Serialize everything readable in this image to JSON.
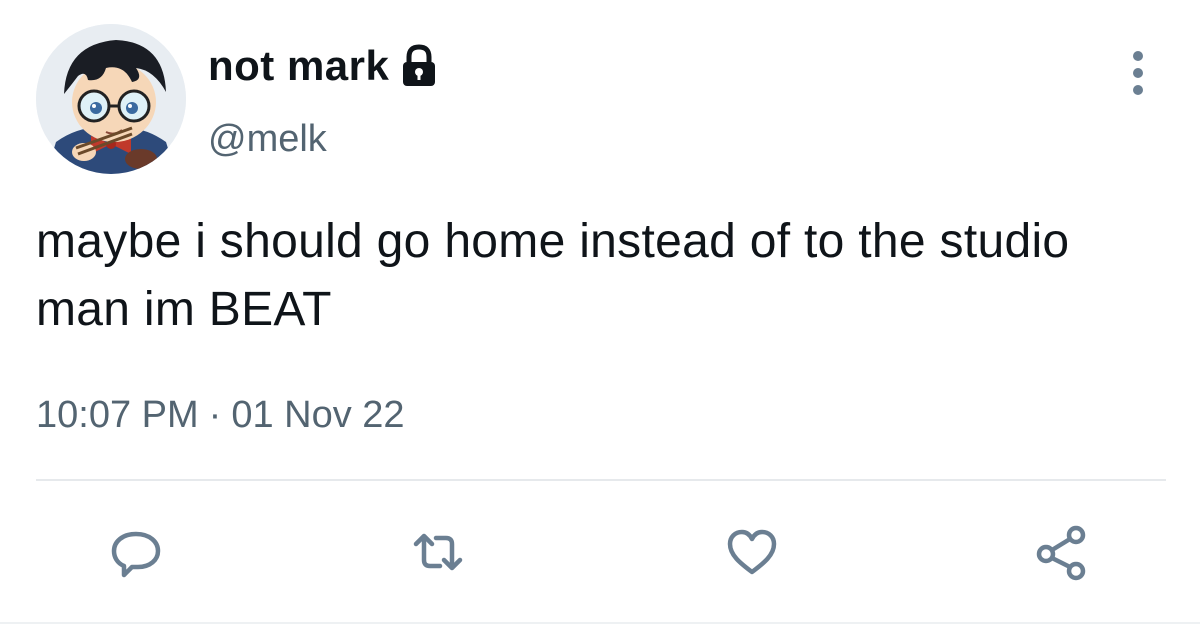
{
  "user": {
    "display_name": "not mark",
    "handle": "@melk",
    "avatar_icon": "avatar-anime-boy-glasses",
    "protected_icon": "lock-icon"
  },
  "tweet": {
    "text": "maybe i should go home instead of to the studio man im BEAT",
    "time": "10:07 PM",
    "separator": "·",
    "date": "01 Nov 22"
  },
  "actions": {
    "more_icon": "more-vertical-icon",
    "reply_icon": "reply-icon",
    "retweet_icon": "retweet-icon",
    "like_icon": "heart-icon",
    "share_icon": "share-icon"
  },
  "colors": {
    "text_primary": "#0f1419",
    "text_secondary": "#536471",
    "icon_gray": "#6b7f92",
    "divider": "#e6e9ec"
  }
}
